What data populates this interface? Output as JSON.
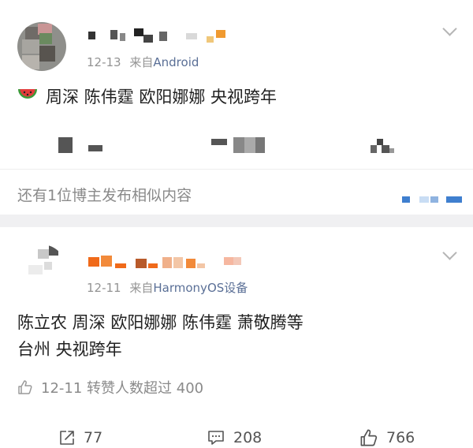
{
  "post1": {
    "date": "12-13",
    "source_prefix": "来自",
    "source": "Android",
    "content_emoji": "🍉",
    "content": "周深 陈伟霆 欧阳娜娜 央视跨年",
    "more_text": "还有1位博主发布相似内容",
    "icons": {
      "menu": "chevron-down-icon",
      "emoji": "watermelon"
    }
  },
  "post2": {
    "date": "12-11",
    "source_prefix": "来自",
    "source": "HarmonyOS设备",
    "content_line1": "陈立农 周深 欧阳娜娜 陈伟霆 萧敬腾等",
    "content_line2": "台州 央视跨年",
    "fwd_info": "12-11 转赞人数超过 400",
    "actions": {
      "repost_count": "77",
      "comment_count": "208",
      "like_count": "766"
    },
    "icons": {
      "menu": "chevron-down-icon",
      "repost": "share-icon",
      "comment": "comment-icon",
      "like": "thumbs-up-icon"
    }
  },
  "colors": {
    "source_link": "#5a6f96",
    "meta_gray": "#939393",
    "divider": "#f0f0f2"
  }
}
